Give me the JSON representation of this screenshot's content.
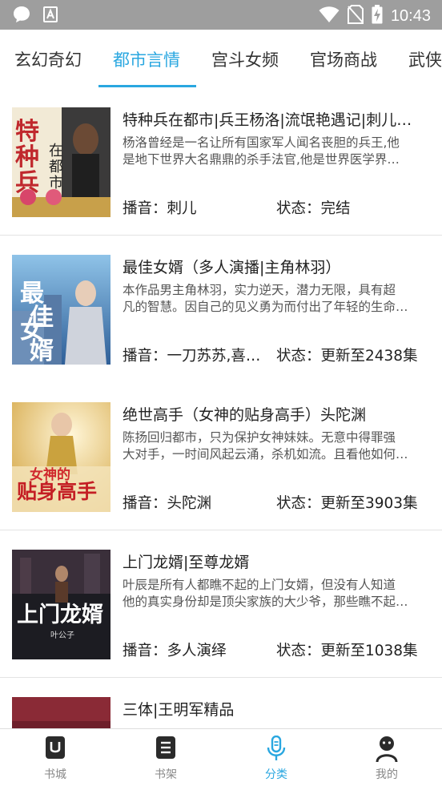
{
  "status_bar": {
    "time": "10:43",
    "icons": [
      "message-icon",
      "a-icon",
      "wifi-icon",
      "no-sim-icon",
      "battery-charging-icon"
    ]
  },
  "tabs": [
    {
      "label": "玄幻奇幻"
    },
    {
      "label": "都市言情",
      "active": true
    },
    {
      "label": "宫斗女频"
    },
    {
      "label": "官场商战"
    },
    {
      "label": "武侠"
    }
  ],
  "books": [
    {
      "title": "特种兵在都市|兵王杨洛|流氓艳遇记|刺儿…",
      "desc_lines": [
        "杨洛曾经是一名让所有国家军人闻名丧胆的兵王,他",
        "是地下世界大名鼎鼎的杀手法官,他是世界医学界…"
      ],
      "narrator": "播音：刺儿",
      "status": "状态：完结",
      "cover_text": "特种兵在都市",
      "cover_color": "#c8a04a"
    },
    {
      "title": "最佳女婿（多人演播|主角林羽）",
      "desc_lines": [
        "本作品男主角林羽，实力逆天，潜力无限，具有超",
        "凡的智慧。因自己的见义勇为而付出了年轻的生命…"
      ],
      "narrator": "播音：一刀苏苏,喜…",
      "status": "状态：更新至2438集",
      "cover_text": "最佳女婿",
      "cover_color": "#3d6fa8"
    },
    {
      "title": "绝世高手（女神的贴身高手）头陀渊",
      "desc_lines": [
        "陈扬回归都市，只为保护女神妹妹。无意中得罪强",
        "大对手，一时间风起云涌，杀机如流。且看他如何…"
      ],
      "narrator": "播音：头陀渊",
      "status": "状态：更新至3903集",
      "cover_text": "女神的贴身高手",
      "cover_color": "#d9b35c"
    },
    {
      "title": "上门龙婿|至尊龙婿",
      "desc_lines": [
        "叶辰是所有人都瞧不起的上门女婿，但没有人知道",
        "他的真实身份却是顶尖家族的大少爷，那些瞧不起…"
      ],
      "narrator": "播音：多人演绎",
      "status": "状态：更新至1038集",
      "cover_text": "上门龙婿",
      "cover_color": "#2a2a30"
    },
    {
      "title": "三体|王明军精品",
      "desc_lines": [
        "",
        ""
      ],
      "narrator": "",
      "status": "",
      "cover_text": "",
      "cover_color": "#7a1f2a"
    }
  ],
  "bottom_nav": [
    {
      "label": "书城",
      "icon": "bookstore-icon"
    },
    {
      "label": "书架",
      "icon": "bookshelf-icon"
    },
    {
      "label": "分类",
      "icon": "microphone-icon",
      "active": true
    },
    {
      "label": "我的",
      "icon": "profile-icon"
    }
  ],
  "colors": {
    "accent": "#2aa7e0",
    "status_bar": "#9e9e9e",
    "divider": "#e3e3e3"
  }
}
